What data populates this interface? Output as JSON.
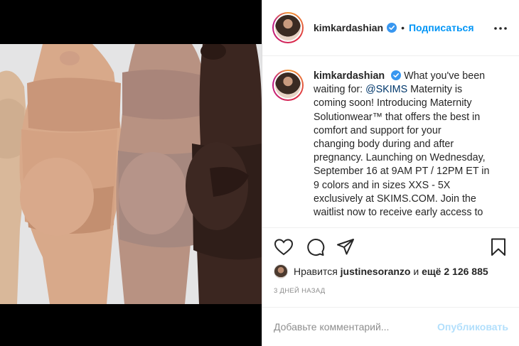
{
  "post": {
    "username": "kimkardashian",
    "follow_label": "Подписаться",
    "separator": "•",
    "caption_username": "kimkardashian",
    "caption_lines": [
      "What you've been",
      "waiting for: ",
      "Maternity is",
      "coming soon! Introducing Maternity",
      "Solutionwear™ that offers the best in",
      "comfort and support for your",
      "changing body during and after",
      "pregnancy. Launching on Wednesday,",
      "September 16 at 9AM PT / 12PM ET in",
      "9 colors and in sizes XXS - 5X",
      "exclusively at SKIMS.COM. Join the",
      "waitlist now to receive early access to"
    ],
    "mention": "@SKIMS",
    "likes_prefix": "Нравится",
    "likes_user": "justinesoranzo",
    "likes_middle": "и",
    "likes_count": "ещё 2 126 885",
    "date": "3 ДНЕЙ НАЗАД",
    "comment_placeholder": "Добавьте комментарий...",
    "publish_label": "Опубликовать"
  },
  "icons": {
    "verified": "verified-badge-icon",
    "more": "more-options-icon",
    "like": "heart-icon",
    "comment": "comment-icon",
    "share": "paper-plane-icon",
    "save": "bookmark-icon"
  },
  "colors": {
    "accent": "#0095f6",
    "publish_disabled": "#b2dffc",
    "muted": "#8e8e8e",
    "mention": "#00376b"
  }
}
